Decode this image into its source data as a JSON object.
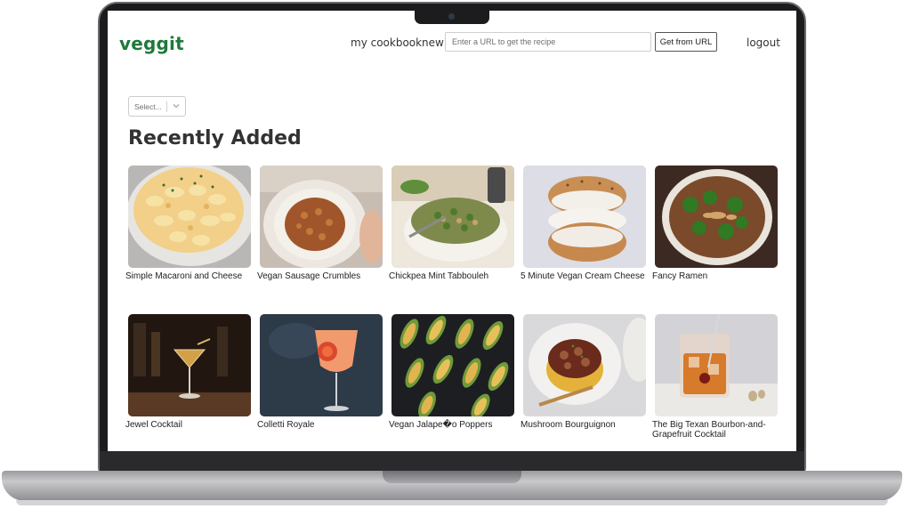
{
  "app": {
    "logo": "veggit"
  },
  "nav": {
    "cookbook_label": "my cookbook",
    "new_label": "new",
    "logout_label": "logout"
  },
  "url_form": {
    "placeholder": "Enter a URL to get the recipe",
    "value": "",
    "button_label": "Get from URL"
  },
  "filter": {
    "selected": "Select..."
  },
  "section": {
    "heading": "Recently Added"
  },
  "recipes": [
    {
      "title": "Simple Macaroni and Cheese",
      "image": "mac-and-cheese-photo"
    },
    {
      "title": "Vegan Sausage Crumbles",
      "image": "sausage-crumbles-photo"
    },
    {
      "title": "Chickpea Mint Tabbouleh",
      "image": "tabbouleh-photo"
    },
    {
      "title": "5 Minute Vegan Cream Cheese",
      "image": "bagel-cream-cheese-photo"
    },
    {
      "title": "Fancy Ramen",
      "image": "ramen-photo"
    },
    {
      "title": "Jewel Cocktail",
      "image": "jewel-cocktail-photo"
    },
    {
      "title": "Colletti Royale",
      "image": "colletti-royale-photo"
    },
    {
      "title": "Vegan Jalape�o Poppers",
      "image": "jalapeno-poppers-photo"
    },
    {
      "title": "Mushroom Bourguignon",
      "image": "mushroom-bourguignon-photo"
    },
    {
      "title": "The Big Texan Bourbon-and-Grapefruit Cocktail",
      "image": "bourbon-cocktail-photo"
    }
  ],
  "colors": {
    "brand": "#1f7a3c",
    "text": "#333333",
    "frame": "#1c1c1e"
  }
}
